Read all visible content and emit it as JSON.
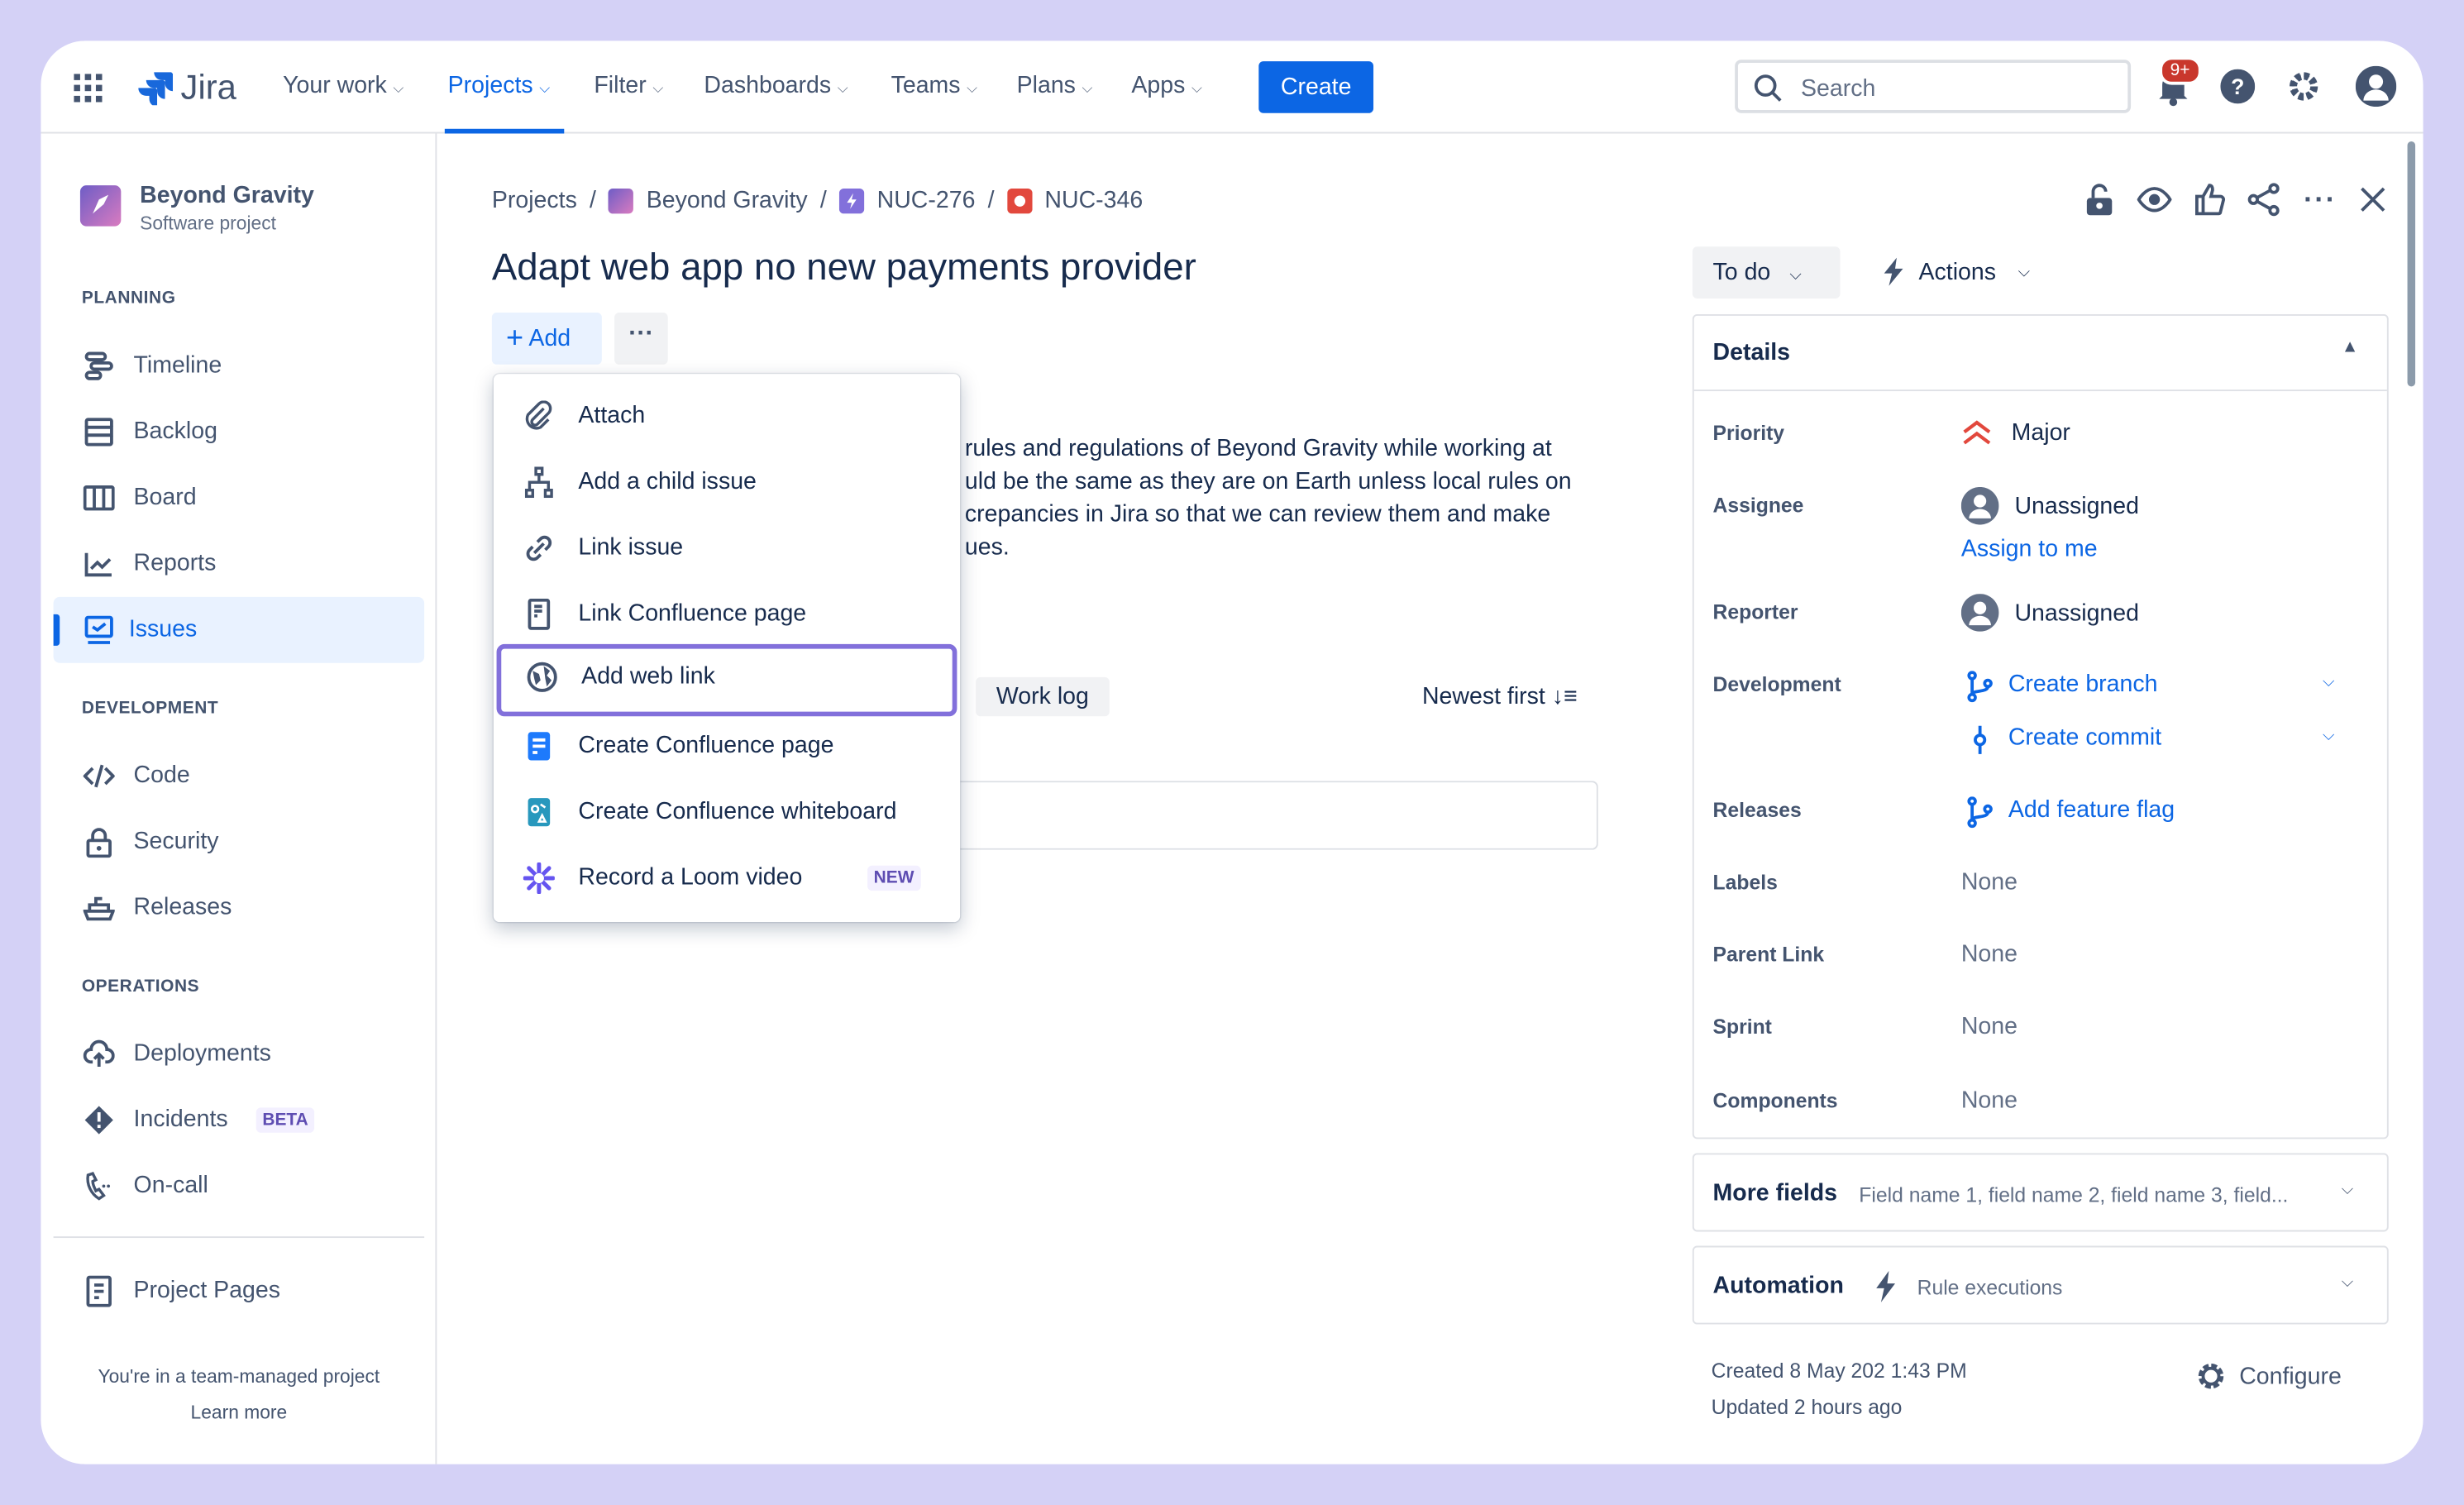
{
  "nav": {
    "logo": "Jira",
    "items": [
      {
        "label": "Your work"
      },
      {
        "label": "Projects",
        "active": true
      },
      {
        "label": "Filter"
      },
      {
        "label": "Dashboards"
      },
      {
        "label": "Teams"
      },
      {
        "label": "Plans"
      },
      {
        "label": "Apps"
      }
    ],
    "create": "Create",
    "search_placeholder": "Search",
    "notifications_badge": "9+"
  },
  "sidebar": {
    "project_name": "Beyond Gravity",
    "project_type": "Software project",
    "sections": [
      {
        "title": "PLANNING"
      },
      {
        "title": "DEVELOPMENT"
      },
      {
        "title": "OPERATIONS"
      }
    ],
    "items": [
      {
        "label": "Timeline",
        "icon": "timeline-icon"
      },
      {
        "label": "Backlog",
        "icon": "backlog-icon"
      },
      {
        "label": "Board",
        "icon": "board-icon"
      },
      {
        "label": "Reports",
        "icon": "reports-icon"
      },
      {
        "label": "Issues",
        "icon": "issues-icon",
        "active": true
      },
      {
        "label": "Code",
        "icon": "code-icon"
      },
      {
        "label": "Security",
        "icon": "lock-icon"
      },
      {
        "label": "Releases",
        "icon": "ship-icon"
      },
      {
        "label": "Deployments",
        "icon": "cloud-icon"
      },
      {
        "label": "Incidents",
        "icon": "incident-icon",
        "badge": "BETA"
      },
      {
        "label": "On-call",
        "icon": "phone-icon"
      },
      {
        "label": "Project Pages",
        "icon": "page-icon"
      }
    ],
    "footer": "You're in a team-managed project",
    "learn_more": "Learn more"
  },
  "breadcrumb": [
    "Projects",
    "Beyond Gravity",
    "NUC-276",
    "NUC-346"
  ],
  "issue": {
    "title": "Adapt web app no new payments provider",
    "add": "Add",
    "description": [
      "rules and regulations of Beyond Gravity while working at",
      "uld be the same as they are on Earth unless local rules on",
      "crepancies in Jira so that we can review them and make",
      "ues."
    ],
    "worklog_tab": "Work log",
    "sort": "Newest first"
  },
  "add_menu": [
    {
      "label": "Attach",
      "icon": "paperclip-icon"
    },
    {
      "label": "Add a child issue",
      "icon": "child-issue-icon"
    },
    {
      "label": "Link issue",
      "icon": "link-icon"
    },
    {
      "label": "Link Confluence page",
      "icon": "confluence-page-icon"
    },
    {
      "label": "Add web link",
      "icon": "globe-icon",
      "selected": true
    },
    {
      "label": "Create Confluence page",
      "icon": "confluence-create-icon"
    },
    {
      "label": "Create Confluence whiteboard",
      "icon": "whiteboard-icon"
    },
    {
      "label": "Record a Loom video",
      "icon": "loom-icon",
      "badge": "NEW"
    }
  ],
  "status": "To do",
  "actions": "Actions",
  "details": {
    "title": "Details",
    "fields": [
      {
        "label": "Priority",
        "value": "Major"
      },
      {
        "label": "Assignee",
        "value": "Unassigned",
        "action": "Assign to me"
      },
      {
        "label": "Reporter",
        "value": "Unassigned"
      },
      {
        "label": "Development",
        "values": [
          "Create branch",
          "Create commit"
        ]
      },
      {
        "label": "Releases",
        "value": "Add feature flag"
      },
      {
        "label": "Labels",
        "value": "None"
      },
      {
        "label": "Parent Link",
        "value": "None"
      },
      {
        "label": "Sprint",
        "value": "None"
      },
      {
        "label": "Components",
        "value": "None"
      }
    ]
  },
  "more_fields": {
    "title": "More fields",
    "summary": "Field name 1, field name 2, field name 3, field..."
  },
  "automation": {
    "title": "Automation",
    "summary": "Rule executions"
  },
  "meta": {
    "created": "Created 8 May 202 1:43 PM",
    "updated": "Updated 2 hours ago",
    "configure": "Configure"
  },
  "colors": {
    "accent": "#0c66e4",
    "selection": "#8270db",
    "frame": "#d4d1f6",
    "badge": "#c9372c"
  }
}
